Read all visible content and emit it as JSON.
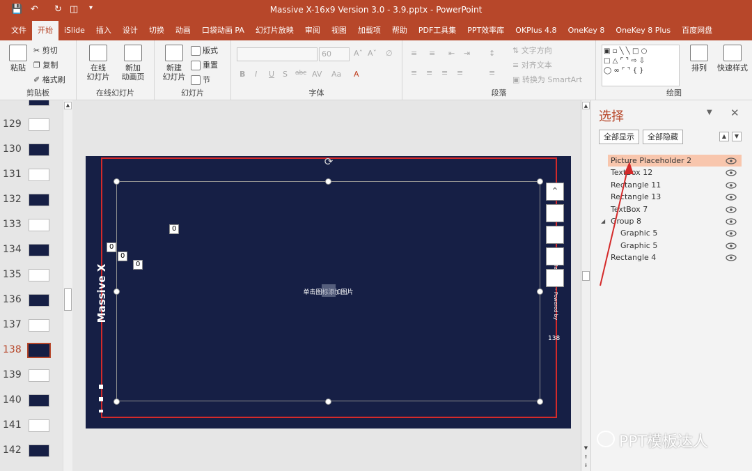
{
  "title": "Massive X-16x9 Version 3.0 - 3.9.pptx  -  PowerPoint",
  "tabs": [
    "文件",
    "开始",
    "iSlide",
    "插入",
    "设计",
    "切换",
    "动画",
    "口袋动画 PA",
    "幻灯片放映",
    "审阅",
    "视图",
    "加载项",
    "帮助",
    "PDF工具集",
    "PPT效率库",
    "OKPlus 4.8",
    "OneKey 8",
    "OneKey 8 Plus",
    "百度网盘"
  ],
  "ribbon": {
    "clipboard": {
      "paste": "粘贴",
      "cut": "剪切",
      "copy": "复制",
      "format_painter": "格式刷",
      "group": "剪贴板"
    },
    "online": {
      "online_slides": "在线\n幻灯片",
      "new_anim": "新加\n动画页",
      "group": "在线幻灯片"
    },
    "slides": {
      "new_slide": "新建\n幻灯片",
      "layout": "版式",
      "reset": "重置",
      "section": "节",
      "group": "幻灯片"
    },
    "font": {
      "size": "60",
      "group": "字体"
    },
    "paragraph": {
      "text_dir": "文字方向",
      "align_text": "对齐文本",
      "smartart": "转换为 SmartArt",
      "group": "段落"
    },
    "drawing": {
      "arrange": "排列",
      "quick_styles": "快速样式",
      "group": "绘图"
    }
  },
  "thumbnails": [
    "129",
    "130",
    "131",
    "132",
    "133",
    "134",
    "135",
    "136",
    "137",
    "138",
    "139",
    "140",
    "141",
    "142"
  ],
  "selected_slide": "138",
  "slide": {
    "placeholder": "单击图标添加图片",
    "side_text": "Massive X",
    "right_text": "Massive X - Powered by",
    "page_number": "138",
    "zero": "0"
  },
  "selection_pane": {
    "title": "选择",
    "show_all": "全部显示",
    "hide_all": "全部隐藏",
    "items": [
      {
        "label": "Picture Placeholder 2",
        "indent": 0
      },
      {
        "label": "TextBox 12",
        "indent": 0
      },
      {
        "label": "Rectangle 11",
        "indent": 0
      },
      {
        "label": "Rectangle 13",
        "indent": 0
      },
      {
        "label": "TextBox 7",
        "indent": 0
      },
      {
        "label": "Group 8",
        "indent": 0
      },
      {
        "label": "Graphic 5",
        "indent": 1
      },
      {
        "label": "Graphic 5",
        "indent": 1
      },
      {
        "label": "Rectangle 4",
        "indent": 0
      }
    ]
  },
  "watermark": "PPT模板达人",
  "colors": {
    "accent": "#b7472a",
    "slide_bg": "#161f45",
    "highlight": "#f8c6ad",
    "arrow": "#d42a2a"
  }
}
